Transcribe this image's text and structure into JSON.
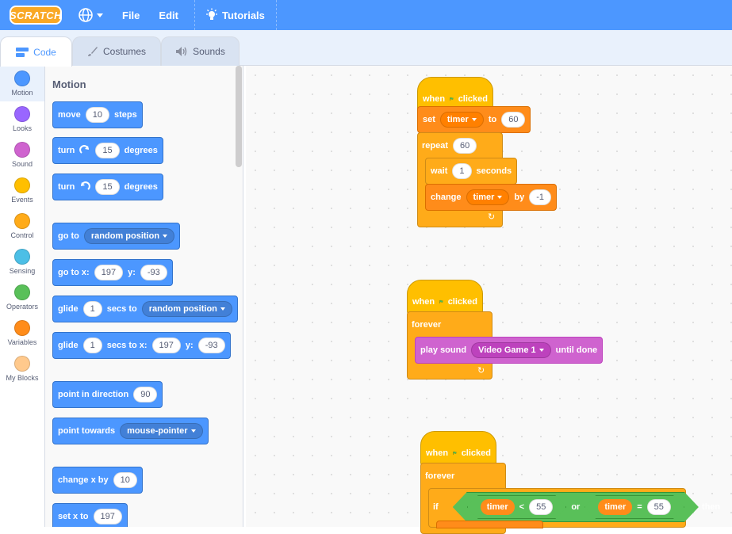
{
  "topbar": {
    "logo": "SCRATCH",
    "file": "File",
    "edit": "Edit",
    "tutorials": "Tutorials",
    "globe_icon": "globe-icon",
    "bulb_icon": "lightbulb-icon"
  },
  "tabs": [
    {
      "label": "Code",
      "icon": "code-icon"
    },
    {
      "label": "Costumes",
      "icon": "brush-icon"
    },
    {
      "label": "Sounds",
      "icon": "speaker-icon"
    }
  ],
  "categories": [
    {
      "label": "Motion",
      "color": "#4c97ff"
    },
    {
      "label": "Looks",
      "color": "#9966ff"
    },
    {
      "label": "Sound",
      "color": "#cf63cf"
    },
    {
      "label": "Events",
      "color": "#ffbf00"
    },
    {
      "label": "Control",
      "color": "#ffab19"
    },
    {
      "label": "Sensing",
      "color": "#4cbfe6"
    },
    {
      "label": "Operators",
      "color": "#59c059"
    },
    {
      "label": "Variables",
      "color": "#ff8c1a"
    },
    {
      "label": "My Blocks",
      "color": "#ff6680"
    }
  ],
  "palette": {
    "title": "Motion",
    "move": {
      "a": "move",
      "n": "10",
      "b": "steps"
    },
    "turn_right": {
      "a": "turn",
      "n": "15",
      "b": "degrees"
    },
    "turn_left": {
      "a": "turn",
      "n": "15",
      "b": "degrees"
    },
    "goto": {
      "a": "go to",
      "dd": "random position"
    },
    "goto_xy": {
      "a": "go to x:",
      "x": "197",
      "b": "y:",
      "y": "-93"
    },
    "glide": {
      "a": "glide",
      "n": "1",
      "b": "secs to",
      "dd": "random position"
    },
    "glide_xy": {
      "a": "glide",
      "n": "1",
      "b": "secs to x:",
      "x": "197",
      "c": "y:",
      "y": "-93"
    },
    "point_dir": {
      "a": "point in direction",
      "n": "90"
    },
    "point_towards": {
      "a": "point towards",
      "dd": "mouse-pointer"
    },
    "change_x": {
      "a": "change x by",
      "n": "10"
    },
    "set_x": {
      "a": "set x to",
      "n": "197"
    }
  },
  "script1": {
    "hat": {
      "a": "when",
      "b": "clicked"
    },
    "set": {
      "a": "set",
      "var": "timer",
      "b": "to",
      "n": "60"
    },
    "repeat": {
      "a": "repeat",
      "n": "60"
    },
    "wait": {
      "a": "wait",
      "n": "1",
      "b": "seconds"
    },
    "change": {
      "a": "change",
      "var": "timer",
      "b": "by",
      "n": "-1"
    }
  },
  "script2": {
    "hat": {
      "a": "when",
      "b": "clicked"
    },
    "forever": "forever",
    "play": {
      "a": "play sound",
      "dd": "Video Game 1",
      "b": "until done"
    }
  },
  "script3": {
    "hat": {
      "a": "when",
      "b": "clicked"
    },
    "forever": "forever",
    "if": {
      "a": "if",
      "var1": "timer",
      "op1": "<",
      "n1": "55",
      "or": "or",
      "var2": "timer",
      "op2": "=",
      "n2": "55",
      "then": "then"
    }
  }
}
